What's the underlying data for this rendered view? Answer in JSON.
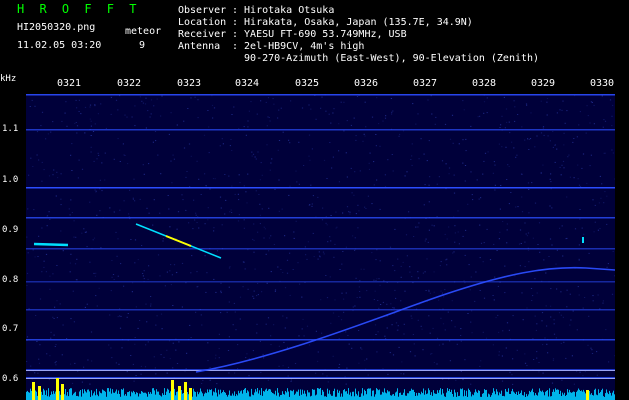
{
  "app": {
    "title": "H R O F F T"
  },
  "file": {
    "name": "HI2050320.png",
    "datetime": "11.02.05 03:20"
  },
  "meteor": {
    "label": "meteor",
    "count": "9"
  },
  "info": [
    {
      "label": "Observer",
      "value": ": Hirotaka Otsuka"
    },
    {
      "label": "Location",
      "value": ": Hirakata, Osaka, Japan (135.7E, 34.9N)"
    },
    {
      "label": "Receiver",
      "value": ": YAESU FT-690 53.749MHz, USB"
    },
    {
      "label": "Antenna",
      "value": ": 2el-HB9CV, 4m's high"
    },
    {
      "label": "",
      "value": "  90-270-Azimuth (East-West), 90-Elevation (Zenith)"
    }
  ],
  "y_unit": "kHz",
  "y_ticks": [
    "1.1",
    "1.0",
    "0.9",
    "0.8",
    "0.7",
    "0.6"
  ],
  "x_ticks": [
    "0321",
    "0322",
    "0323",
    "0324",
    "0325",
    "0326",
    "0327",
    "0328",
    "0329",
    "0330"
  ],
  "colors": {
    "background": "#000000",
    "plot": "#00003a",
    "title": "#00ff00",
    "trace": "#2b4dff",
    "echo": "#00e0ff",
    "noise": "#00c8ff",
    "burst": "#ffff00"
  }
}
